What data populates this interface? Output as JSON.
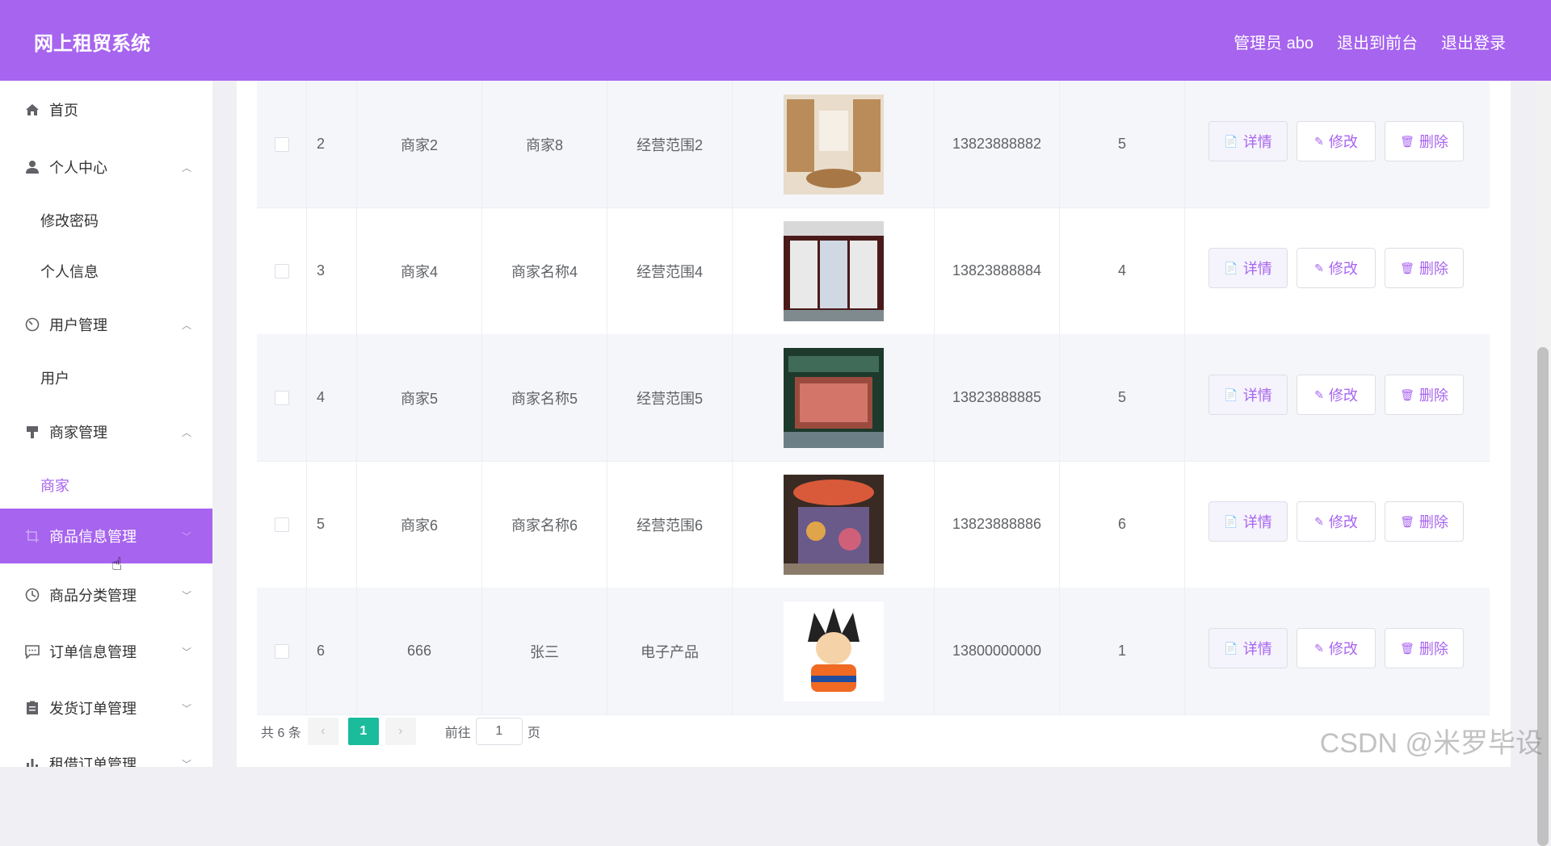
{
  "header": {
    "title": "网上租贸系统",
    "admin": "管理员 abo",
    "back_front": "退出到前台",
    "logout": "退出登录"
  },
  "sidebar": {
    "home": "首页",
    "personal_center": "个人中心",
    "change_password": "修改密码",
    "personal_info": "个人信息",
    "user_mgmt": "用户管理",
    "user": "用户",
    "merchant_mgmt": "商家管理",
    "merchant": "商家",
    "product_info_mgmt": "商品信息管理",
    "category_mgmt": "商品分类管理",
    "order_info_mgmt": "订单信息管理",
    "shipping_mgmt": "发货订单管理",
    "lease_mgmt": "租借订单管理"
  },
  "rows": [
    {
      "index": "2",
      "account": "商家2",
      "name": "商家8",
      "scope": "经营范围2",
      "phone": "13823888882",
      "level": "5"
    },
    {
      "index": "3",
      "account": "商家4",
      "name": "商家名称4",
      "scope": "经营范围4",
      "phone": "13823888884",
      "level": "4"
    },
    {
      "index": "4",
      "account": "商家5",
      "name": "商家名称5",
      "scope": "经营范围5",
      "phone": "13823888885",
      "level": "5"
    },
    {
      "index": "5",
      "account": "商家6",
      "name": "商家名称6",
      "scope": "经营范围6",
      "phone": "13823888886",
      "level": "6"
    },
    {
      "index": "6",
      "account": "666",
      "name": "张三",
      "scope": "电子产品",
      "phone": "13800000000",
      "level": "1"
    }
  ],
  "actions": {
    "detail": "详情",
    "edit": "修改",
    "delete": "删除"
  },
  "pager": {
    "total": "共 6 条",
    "page": "1",
    "goto": "前往",
    "goto_value": "1",
    "page_unit": "页"
  },
  "watermark": "CSDN @米罗毕设"
}
